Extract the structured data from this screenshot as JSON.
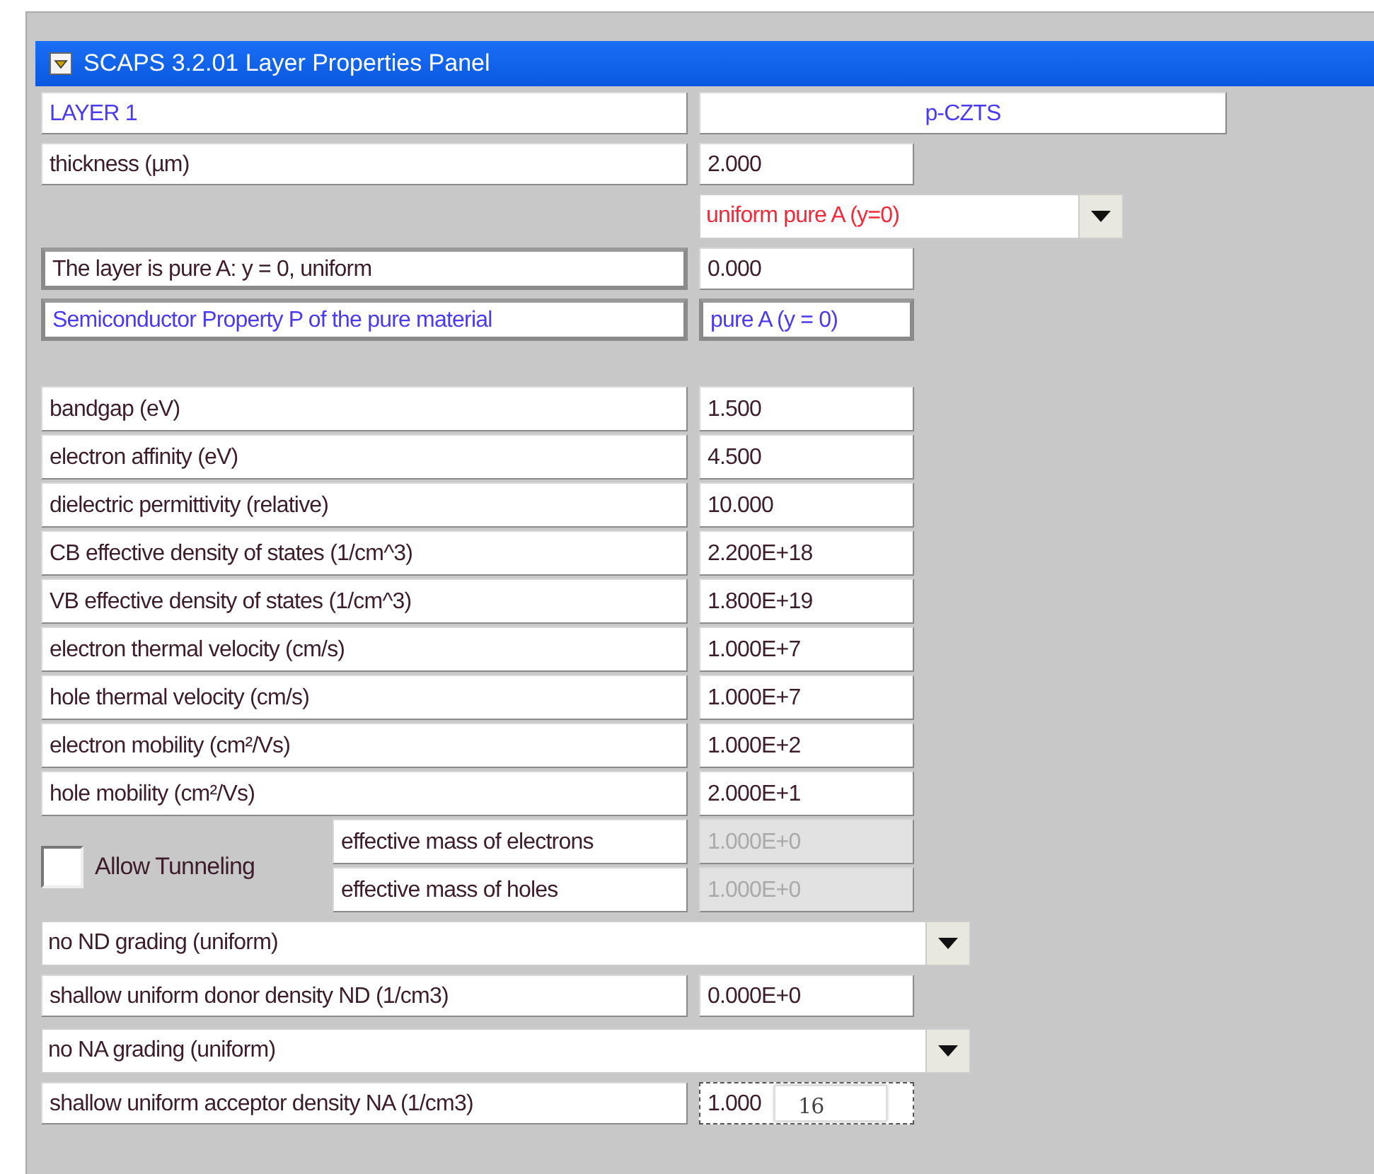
{
  "window": {
    "title": "SCAPS 3.2.01 Layer Properties Panel"
  },
  "layer": {
    "label": "LAYER 1",
    "name": "p-CZTS"
  },
  "thickness": {
    "label": "thickness (µm)",
    "value": "2.000"
  },
  "composition": {
    "grading": "uniform pure A (y=0)",
    "description": "The layer is pure A: y = 0, uniform",
    "description_value": "0.000",
    "property_label": "Semiconductor Property P of the pure material",
    "property_value": "pure A (y = 0)"
  },
  "properties": [
    {
      "label": "bandgap (eV)",
      "value": "1.500"
    },
    {
      "label": "electron affinity (eV)",
      "value": "4.500"
    },
    {
      "label": "dielectric permittivity (relative)",
      "value": "10.000"
    },
    {
      "label": "CB effective density of states (1/cm^3)",
      "value": "2.200E+18"
    },
    {
      "label": "VB effective density of states (1/cm^3)",
      "value": "1.800E+19"
    },
    {
      "label": "electron thermal velocity (cm/s)",
      "value": "1.000E+7"
    },
    {
      "label": "hole thermal velocity (cm/s)",
      "value": "1.000E+7"
    },
    {
      "label": "electron mobility (cm²/Vs)",
      "value": "1.000E+2"
    },
    {
      "label": "hole mobility (cm²/Vs)",
      "value": "2.000E+1"
    }
  ],
  "tunneling": {
    "label": "Allow Tunneling",
    "checked": false,
    "masses": [
      {
        "label": "effective mass of electrons",
        "value": "1.000E+0",
        "disabled": true
      },
      {
        "label": "effective mass of holes",
        "value": "1.000E+0",
        "disabled": true
      }
    ]
  },
  "donor": {
    "grading": "no ND grading (uniform)",
    "label": "shallow uniform donor density ND (1/cm3)",
    "value": "0.000E+0"
  },
  "acceptor": {
    "grading": "no NA grading (uniform)",
    "label": "shallow uniform acceptor density NA (1/cm3)",
    "value": "1.000",
    "exponent": "16"
  }
}
